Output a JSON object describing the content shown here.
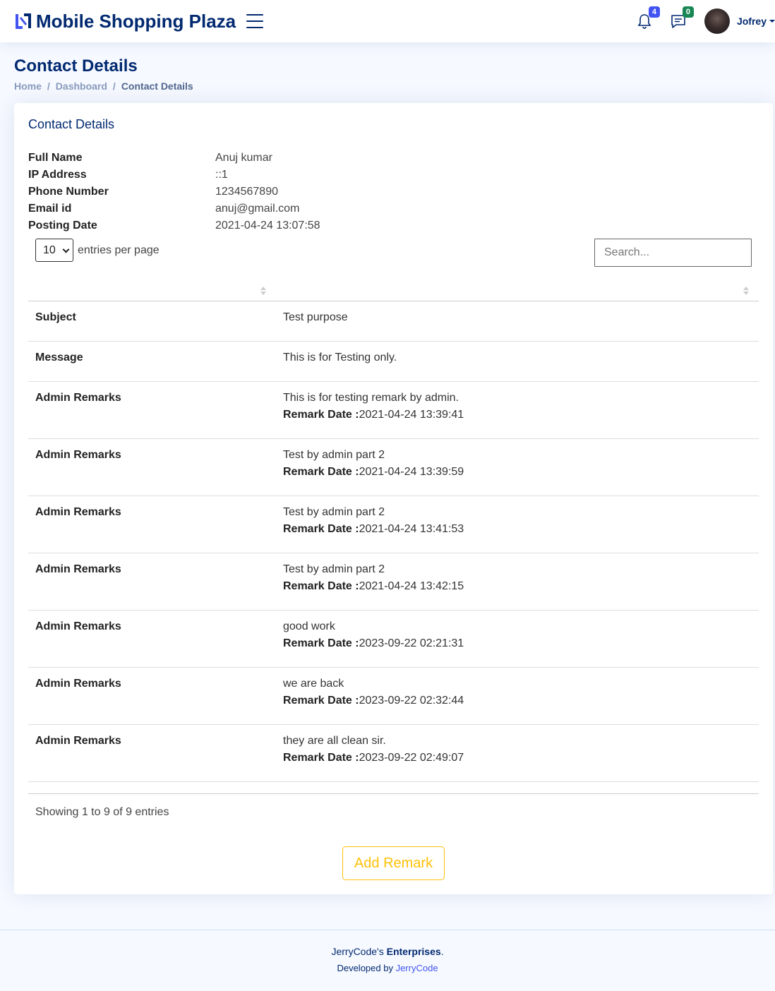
{
  "header": {
    "brand": "Mobile Shopping Plaza",
    "notifications_count": "4",
    "messages_count": "0",
    "user_name": "Jofrey",
    "colors": {
      "brand": "#012970",
      "accent": "#4154f1",
      "success": "#198754"
    }
  },
  "page": {
    "title": "Contact Details",
    "breadcrumb": [
      "Home",
      "Dashboard",
      "Contact Details"
    ]
  },
  "card": {
    "title": "Contact Details",
    "info": [
      {
        "label": "Full Name",
        "value": "Anuj kumar"
      },
      {
        "label": "IP Address",
        "value": "::1"
      },
      {
        "label": "Phone Number",
        "value": "1234567890"
      },
      {
        "label": "Email id",
        "value": "anuj@gmail.com"
      },
      {
        "label": "Posting Date",
        "value": "2021-04-24 13:07:58"
      }
    ],
    "entries_value": "10",
    "entries_label": "entries per page",
    "search_placeholder": "Search...",
    "remark_date_label": "Remark Date :",
    "rows": [
      {
        "label": "Subject",
        "text": "Test purpose"
      },
      {
        "label": "Message",
        "text": "This is for Testing only."
      },
      {
        "label": "Admin Remarks",
        "text": "This is for testing remark by admin.",
        "date": "2021-04-24 13:39:41"
      },
      {
        "label": "Admin Remarks",
        "text": "Test by admin part 2",
        "date": "2021-04-24 13:39:59"
      },
      {
        "label": "Admin Remarks",
        "text": "Test by admin part 2",
        "date": "2021-04-24 13:41:53"
      },
      {
        "label": "Admin Remarks",
        "text": "Test by admin part 2",
        "date": "2021-04-24 13:42:15"
      },
      {
        "label": "Admin Remarks",
        "text": "good work",
        "date": "2023-09-22 02:21:31"
      },
      {
        "label": "Admin Remarks",
        "text": "we are back",
        "date": "2023-09-22 02:32:44"
      },
      {
        "label": "Admin Remarks",
        "text": "they are all clean sir.",
        "date": "2023-09-22 02:49:07"
      }
    ],
    "showing_text": "Showing 1 to 9 of 9 entries",
    "add_remark_label": "Add Remark"
  },
  "footer": {
    "copy_prefix": "JerryCode's ",
    "copy_strong": "Enterprises",
    "copy_suffix": ".",
    "credits_prefix": "Developed by ",
    "credits_link": "JerryCode"
  }
}
